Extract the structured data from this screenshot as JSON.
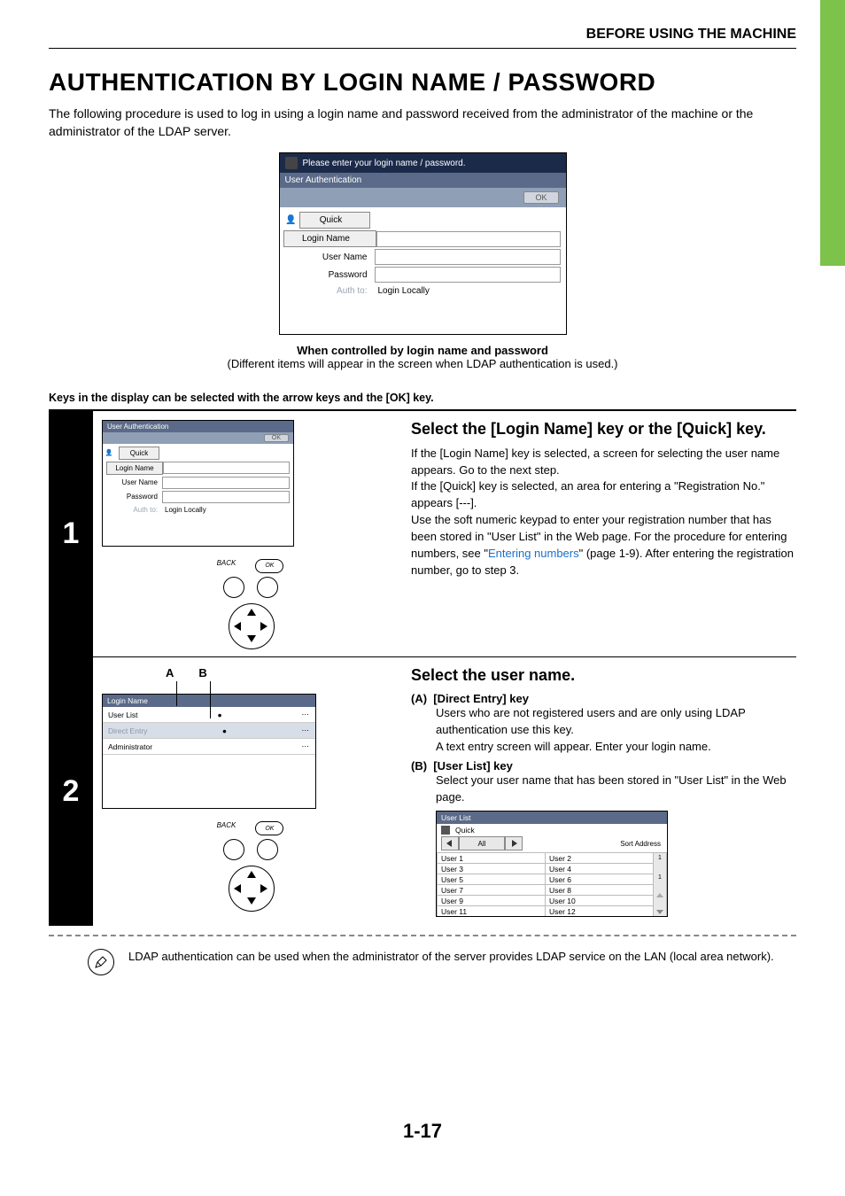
{
  "header": {
    "section": "BEFORE USING THE MACHINE"
  },
  "title": "AUTHENTICATION BY LOGIN NAME / PASSWORD",
  "intro": "The following procedure is used to log in using a login name and password received from the administrator of the machine or the administrator of the LDAP server.",
  "fig1": {
    "prompt": "Please enter your login name / password.",
    "subtitle": "User Authentication",
    "ok": "OK",
    "quick": "Quick",
    "login_name": "Login Name",
    "user_name": "User Name",
    "password": "Password",
    "auth_to": "Auth to:",
    "auth_val": "Login Locally",
    "caption_bold": "When controlled by login name and password",
    "caption_sub": "(Different items will appear in the screen when LDAP authentication is used.)"
  },
  "keys_note": "Keys in the display can be selected with the arrow keys and the [OK] key.",
  "step1": {
    "num": "1",
    "panel": {
      "subtitle": "User Authentication",
      "ok": "OK",
      "quick": "Quick",
      "login_name": "Login Name",
      "user_name": "User Name",
      "password": "Password",
      "auth_to": "Auth to:",
      "auth_val": "Login Locally"
    },
    "back": "BACK",
    "ok": "OK",
    "heading": "Select the [Login Name] key or the [Quick] key.",
    "p1": "If the [Login Name] key is selected, a screen for selecting the user name appears. Go to the next step.",
    "p2a": "If the [Quick] key is selected, an area for entering a \"Registration No.\" appears [---].",
    "p3a": "Use the soft numeric keypad to enter your registration number that has been stored in \"User List\" in the Web page. For the procedure for entering numbers, see \"",
    "link": "Entering numbers",
    "p3b": "\" (page 1-9). After entering the registration number, go to step 3."
  },
  "step2": {
    "num": "2",
    "labels": {
      "a": "A",
      "b": "B"
    },
    "panel": {
      "head": "Login Name",
      "user_list": "User List",
      "direct_entry": "Direct Entry",
      "admin": "Administrator",
      "ell": "⋯"
    },
    "back": "BACK",
    "ok": "OK",
    "heading": "Select the user name.",
    "a_label": "(A)",
    "a_title": "[Direct Entry] key",
    "a_p1": "Users who are not registered users and are only using LDAP authentication use this key.",
    "a_p2": "A text entry screen will appear. Enter your login name.",
    "b_label": "(B)",
    "b_title": "[User List] key",
    "b_p1": "Select your user name that has been stored in \"User List\" in the Web page.",
    "userlist": {
      "head": "User List",
      "quick": "Quick",
      "all": "All",
      "sort": "Sort Address",
      "users": [
        "User 1",
        "User 2",
        "User 3",
        "User 4",
        "User 5",
        "User 6",
        "User 7",
        "User 8",
        "User 9",
        "User 10",
        "User 11",
        "User 12"
      ],
      "count_top": "1",
      "count_bot": "1"
    }
  },
  "note": "LDAP authentication can be used when the administrator of the server provides LDAP service on the LAN (local area network).",
  "pagenum": "1-17"
}
